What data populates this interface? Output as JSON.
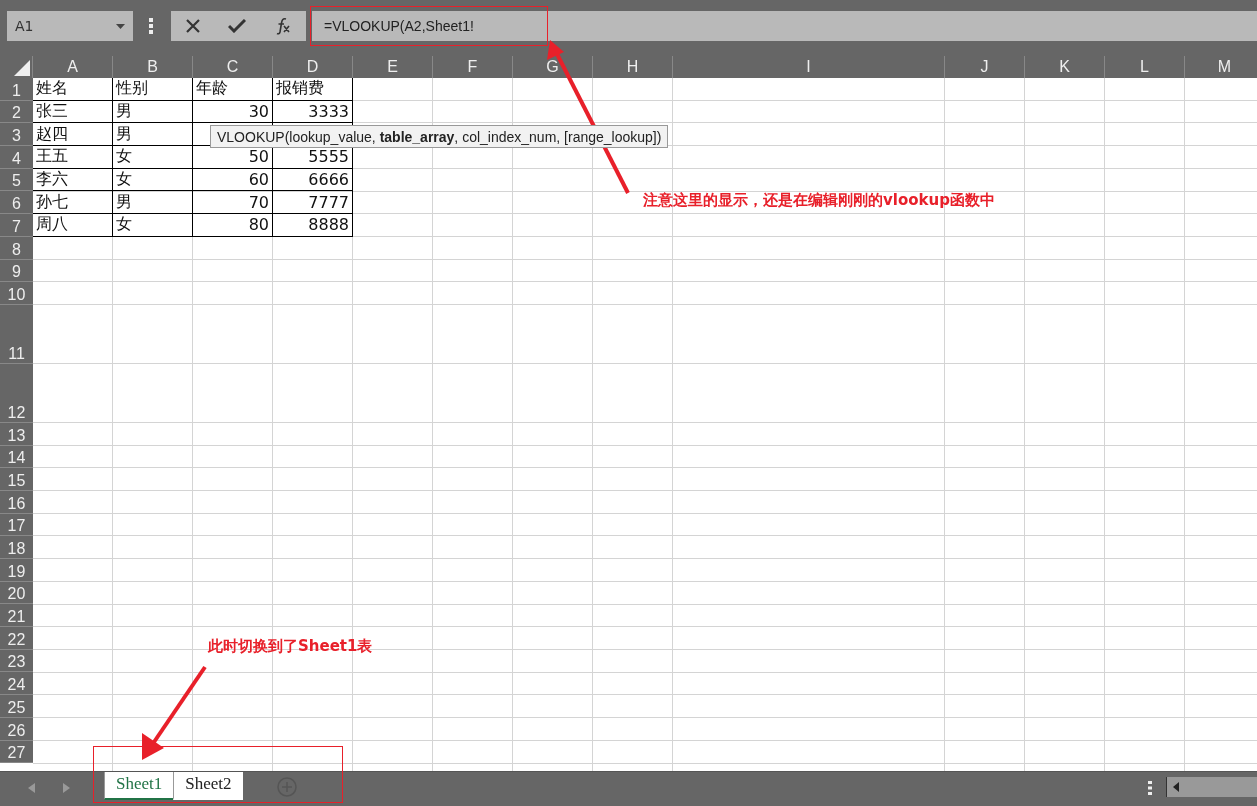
{
  "name_box": {
    "value": "A1"
  },
  "formula_bar": {
    "value": "=VLOOKUP(A2,Sheet1!"
  },
  "columns": [
    {
      "label": "A",
      "kind": "normal"
    },
    {
      "label": "B",
      "kind": "normal"
    },
    {
      "label": "C",
      "kind": "normal"
    },
    {
      "label": "D",
      "kind": "normal"
    },
    {
      "label": "E",
      "kind": "normal"
    },
    {
      "label": "F",
      "kind": "normal"
    },
    {
      "label": "G",
      "kind": "normal"
    },
    {
      "label": "H",
      "kind": "normal"
    },
    {
      "label": "I",
      "kind": "wide"
    },
    {
      "label": "J",
      "kind": "normal"
    },
    {
      "label": "K",
      "kind": "normal"
    },
    {
      "label": "L",
      "kind": "normal"
    },
    {
      "label": "M",
      "kind": "normal"
    }
  ],
  "rows": [
    {
      "number": "1",
      "kind": "normal",
      "cells": [
        {
          "text": "姓名",
          "kind": "text"
        },
        {
          "text": "性别",
          "kind": "text"
        },
        {
          "text": "年龄",
          "kind": "text"
        },
        {
          "text": "报销费",
          "kind": "text"
        }
      ]
    },
    {
      "number": "2",
      "kind": "normal",
      "cells": [
        {
          "text": "张三",
          "kind": "text"
        },
        {
          "text": "男",
          "kind": "text"
        },
        {
          "text": "30",
          "kind": "number"
        },
        {
          "text": "3333",
          "kind": "number"
        }
      ]
    },
    {
      "number": "3",
      "kind": "normal",
      "cells": [
        {
          "text": "赵四",
          "kind": "text"
        },
        {
          "text": "男",
          "kind": "text"
        },
        {
          "kind": "number"
        },
        {
          "kind": "number"
        }
      ]
    },
    {
      "number": "4",
      "kind": "normal",
      "cells": [
        {
          "text": "王五",
          "kind": "text"
        },
        {
          "text": "女",
          "kind": "text"
        },
        {
          "text": "50",
          "kind": "number"
        },
        {
          "text": "5555",
          "kind": "number"
        }
      ]
    },
    {
      "number": "5",
      "kind": "normal",
      "cells": [
        {
          "text": "李六",
          "kind": "text"
        },
        {
          "text": "女",
          "kind": "text"
        },
        {
          "text": "60",
          "kind": "number"
        },
        {
          "text": "6666",
          "kind": "number"
        }
      ]
    },
    {
      "number": "6",
      "kind": "normal",
      "cells": [
        {
          "text": "孙七",
          "kind": "text"
        },
        {
          "text": "男",
          "kind": "text"
        },
        {
          "text": "70",
          "kind": "number"
        },
        {
          "text": "7777",
          "kind": "number"
        }
      ]
    },
    {
      "number": "7",
      "kind": "normal",
      "cells": [
        {
          "text": "周八",
          "kind": "text"
        },
        {
          "text": "女",
          "kind": "text"
        },
        {
          "text": "80",
          "kind": "number"
        },
        {
          "text": "8888",
          "kind": "number"
        }
      ]
    },
    {
      "number": "8",
      "kind": "normal"
    },
    {
      "number": "9",
      "kind": "normal"
    },
    {
      "number": "10",
      "kind": "normal"
    },
    {
      "number": "11",
      "kind": "tall"
    },
    {
      "number": "12",
      "kind": "tall"
    },
    {
      "number": "13",
      "kind": "normal"
    },
    {
      "number": "14",
      "kind": "normal"
    },
    {
      "number": "15",
      "kind": "normal"
    },
    {
      "number": "16",
      "kind": "normal"
    },
    {
      "number": "17",
      "kind": "normal"
    },
    {
      "number": "18",
      "kind": "normal"
    },
    {
      "number": "19",
      "kind": "normal"
    },
    {
      "number": "20",
      "kind": "normal"
    },
    {
      "number": "21",
      "kind": "normal"
    },
    {
      "number": "22",
      "kind": "normal"
    },
    {
      "number": "23",
      "kind": "normal"
    },
    {
      "number": "24",
      "kind": "normal"
    },
    {
      "number": "25",
      "kind": "normal"
    },
    {
      "number": "26",
      "kind": "normal"
    },
    {
      "number": "27",
      "kind": "normal"
    }
  ],
  "tooltip": "VLOOKUP(lookup_value, **table_array**, col_index_num, [range_lookup])",
  "sheet_tabs": [
    {
      "label": "Sheet1",
      "selected": true
    },
    {
      "label": "Sheet2",
      "selected": false
    }
  ],
  "annotations": [
    {
      "text": "注意这里的显示，还是在编辑刚刚的vlookup函数中"
    },
    {
      "text": "此时切换到了Sheet1表"
    }
  ]
}
